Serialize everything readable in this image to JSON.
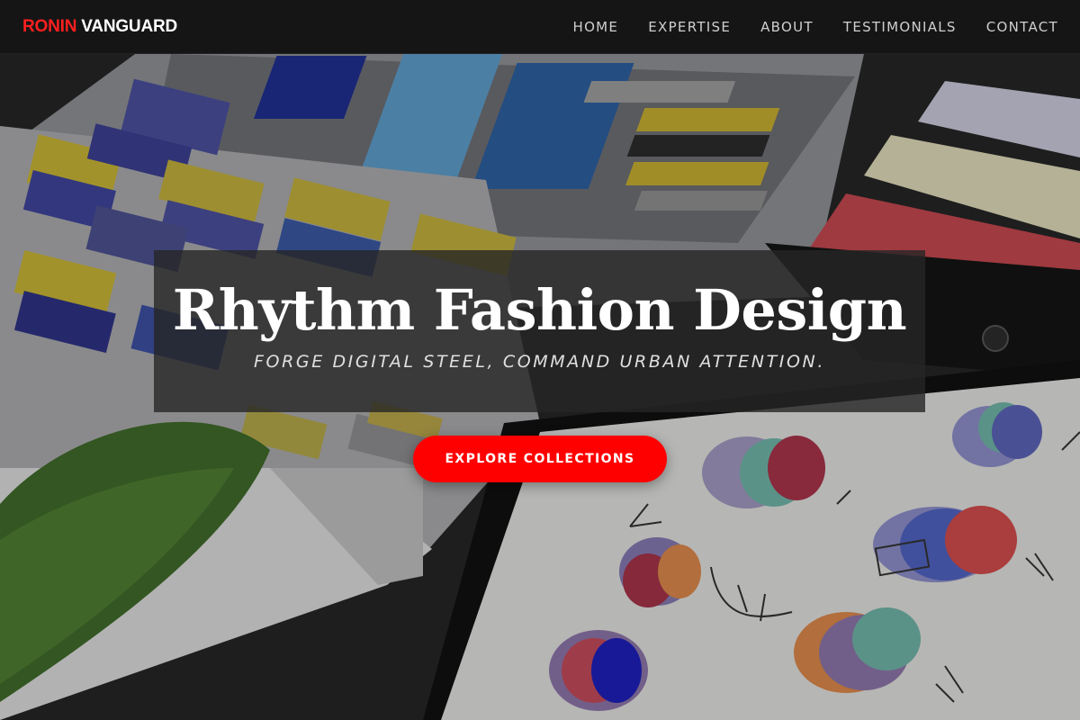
{
  "brand": {
    "part1": "RONIN",
    "part2": "VANGUARD",
    "accent_color": "#ff1f1f"
  },
  "nav": {
    "items": [
      {
        "label": "HOME"
      },
      {
        "label": "EXPERTISE"
      },
      {
        "label": "ABOUT"
      },
      {
        "label": "TESTIMONIALS"
      },
      {
        "label": "CONTACT"
      }
    ]
  },
  "hero": {
    "title": "Rhythm Fashion Design",
    "tagline": "Forge digital steel, command urban attention.",
    "cta_label": "EXPLORE COLLECTIONS",
    "cta_color": "#ff0000",
    "background_image": "desk with color swatch catalog, tablet with fabric sketches, paper swatch strips, green leaf"
  }
}
